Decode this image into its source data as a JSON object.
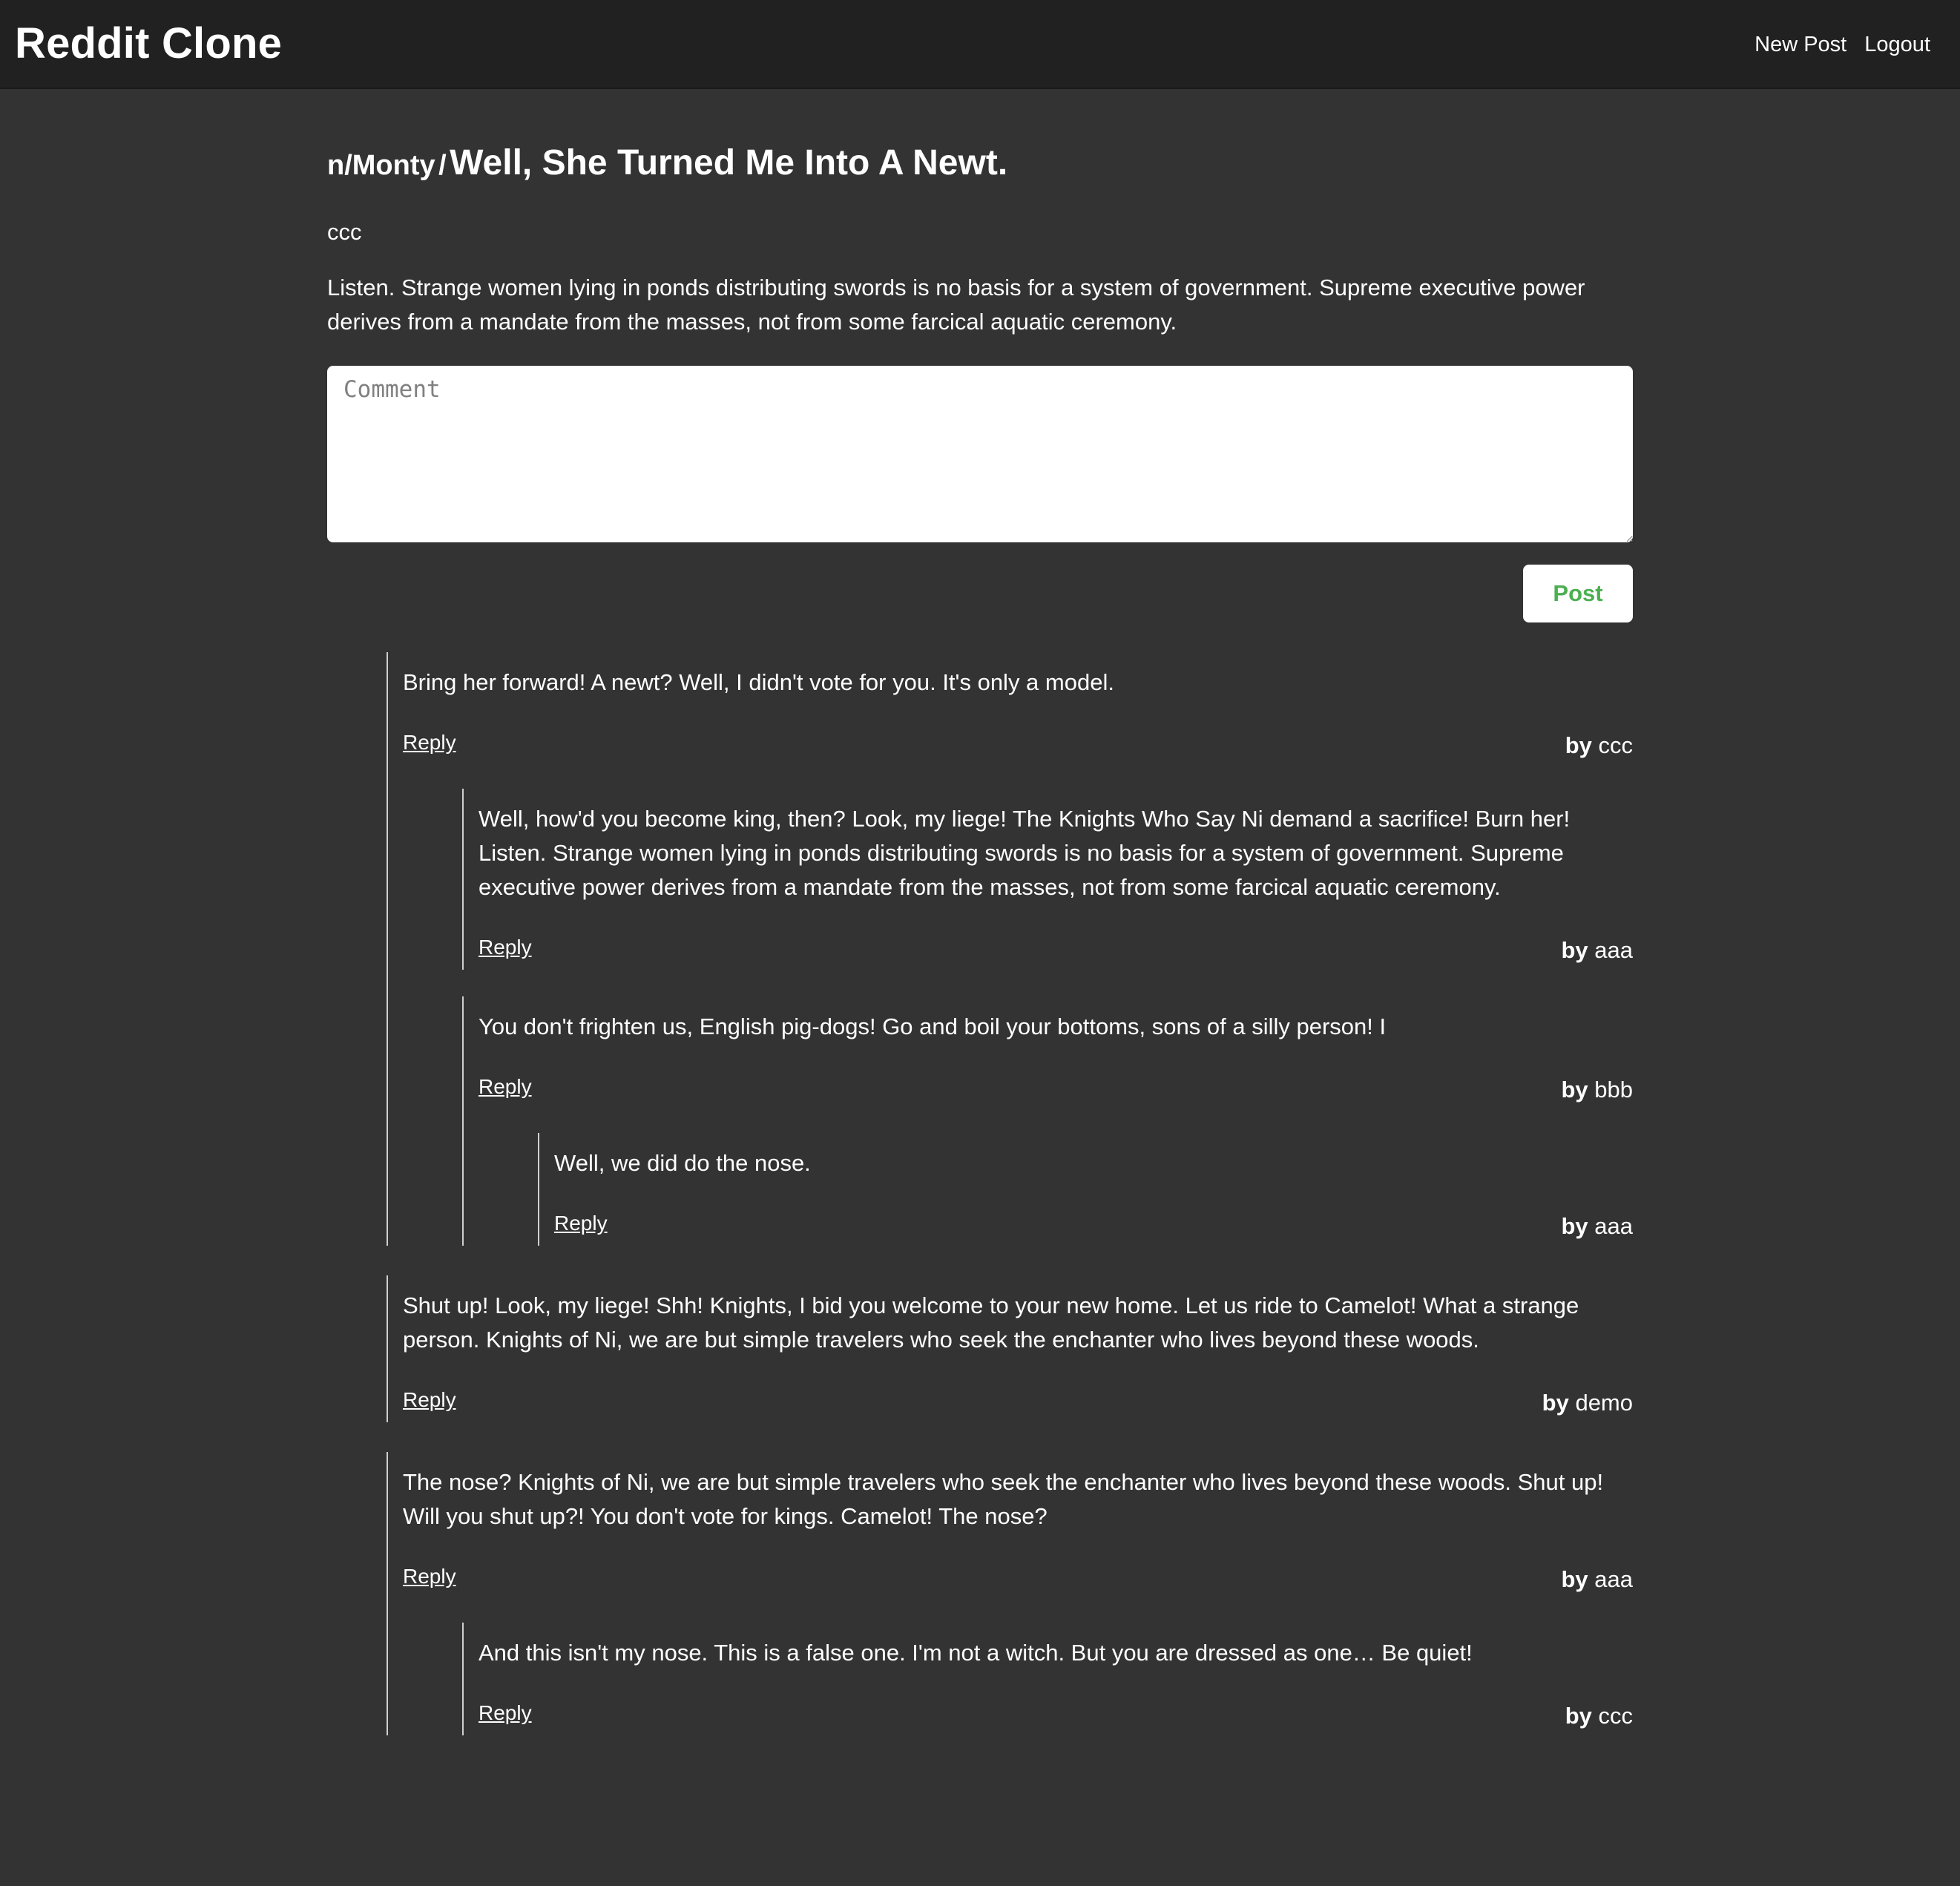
{
  "app": {
    "title": "Reddit Clone",
    "nav": {
      "new_post": "New Post",
      "logout": "Logout"
    }
  },
  "post": {
    "subreddit": "n/Monty",
    "separator": "/",
    "title": "Well, She Turned Me Into A Newt.",
    "author": "ccc",
    "body": "Listen. Strange women lying in ponds distributing swords is no basis for a system of government. Supreme executive power derives from a mandate from the masses, not from some farcical aquatic ceremony."
  },
  "comment_form": {
    "placeholder": "Comment",
    "value": "",
    "submit_label": "Post"
  },
  "labels": {
    "reply": "Reply",
    "by": "by"
  },
  "comments": [
    {
      "text": "Bring her forward! A newt? Well, I didn't vote for you. It's only a model.",
      "author": "ccc",
      "children": [
        {
          "text": "Well, how'd you become king, then? Look, my liege! The Knights Who Say Ni demand a sacrifice! Burn her! Listen. Strange women lying in ponds distributing swords is no basis for a system of government. Supreme executive power derives from a mandate from the masses, not from some farcical aquatic ceremony.",
          "author": "aaa",
          "children": []
        },
        {
          "text": "You don't frighten us, English pig-dogs! Go and boil your bottoms, sons of a silly person! I",
          "author": "bbb",
          "children": [
            {
              "text": "Well, we did do the nose.",
              "author": "aaa",
              "children": []
            }
          ]
        }
      ]
    },
    {
      "text": "Shut up! Look, my liege! Shh! Knights, I bid you welcome to your new home. Let us ride to Camelot! What a strange person. Knights of Ni, we are but simple travelers who seek the enchanter who lives beyond these woods.",
      "author": "demo",
      "children": []
    },
    {
      "text": "The nose? Knights of Ni, we are but simple travelers who seek the enchanter who lives beyond these woods. Shut up! Will you shut up?! You don't vote for kings. Camelot! The nose?",
      "author": "aaa",
      "children": [
        {
          "text": "And this isn't my nose. This is a false one. I'm not a witch. But you are dressed as one… Be quiet!",
          "author": "ccc",
          "children": []
        }
      ]
    }
  ]
}
